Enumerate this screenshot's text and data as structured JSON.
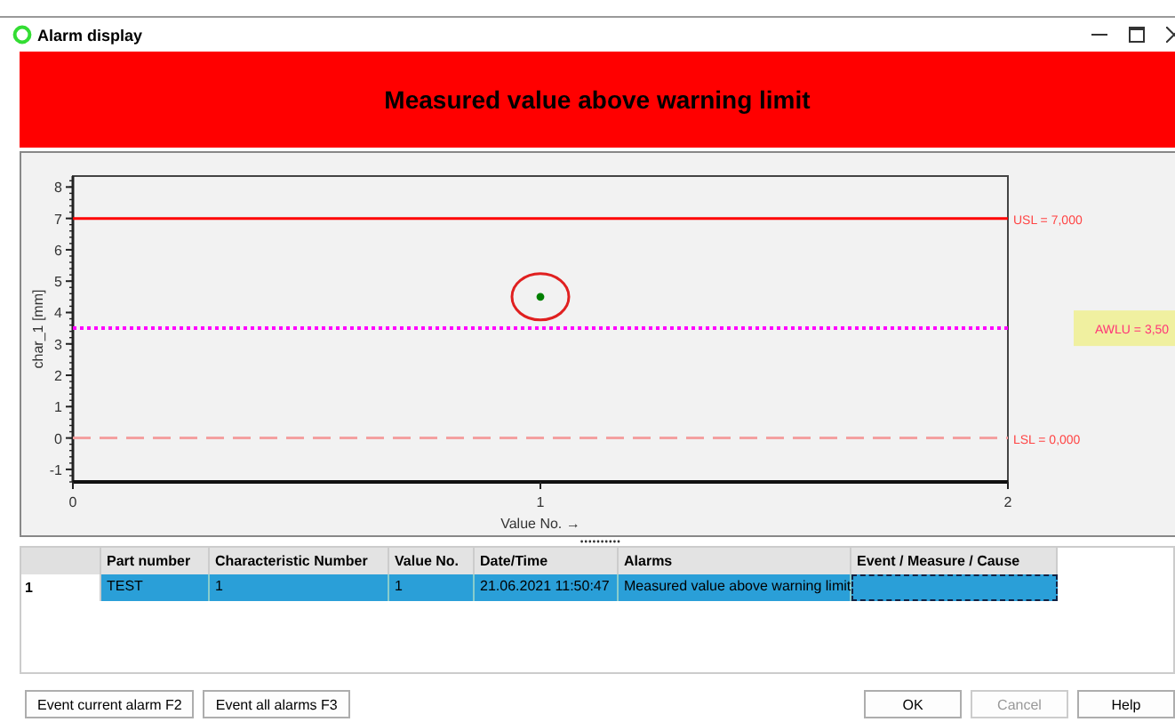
{
  "window": {
    "title": "Alarm display"
  },
  "banner": {
    "text": "Measured value above warning limit"
  },
  "chart": {
    "chart_data": {
      "type": "scatter",
      "xlabel": "Value No. →",
      "ylabel": "char_1 [mm]",
      "x": [
        1
      ],
      "series": [
        {
          "color": "#008000",
          "values": [
            4.5
          ]
        }
      ],
      "xlim": [
        0,
        2
      ],
      "ylim": [
        -1.4,
        8.35
      ],
      "xticks": [
        0,
        1,
        2
      ],
      "yticks": [
        -1,
        0,
        1,
        2,
        3,
        4,
        5,
        6,
        7,
        8
      ],
      "ref_lines": [
        {
          "axis": "y",
          "value": 7,
          "label": "USL = 7,000",
          "color": "#ff0000"
        },
        {
          "axis": "y",
          "value": 3.5,
          "color": "#ff00ff"
        },
        {
          "axis": "y",
          "value": 0,
          "label": "LSL = 0,000",
          "color": "#f4a0a0"
        }
      ]
    },
    "warning_tag": "AWLU = 3,50"
  },
  "table": {
    "columns": [
      "Part number",
      "Characteristic Number",
      "Value No.",
      "Date/Time",
      "Alarms",
      "Event / Measure / Cause"
    ],
    "rows": [
      {
        "header": "1",
        "selected": true,
        "cells": [
          "TEST",
          "1",
          "1",
          "21.06.2021 11:50:47",
          "Measured value above warning limit",
          ""
        ]
      }
    ]
  },
  "buttons_left": [
    {
      "label": "Event current alarm F2",
      "disabled": false
    },
    {
      "label": "Event all alarms F3",
      "disabled": false
    }
  ],
  "buttons_right": [
    {
      "label": "OK",
      "disabled": false
    },
    {
      "label": "Cancel",
      "disabled": true
    },
    {
      "label": "Help",
      "disabled": false
    }
  ]
}
